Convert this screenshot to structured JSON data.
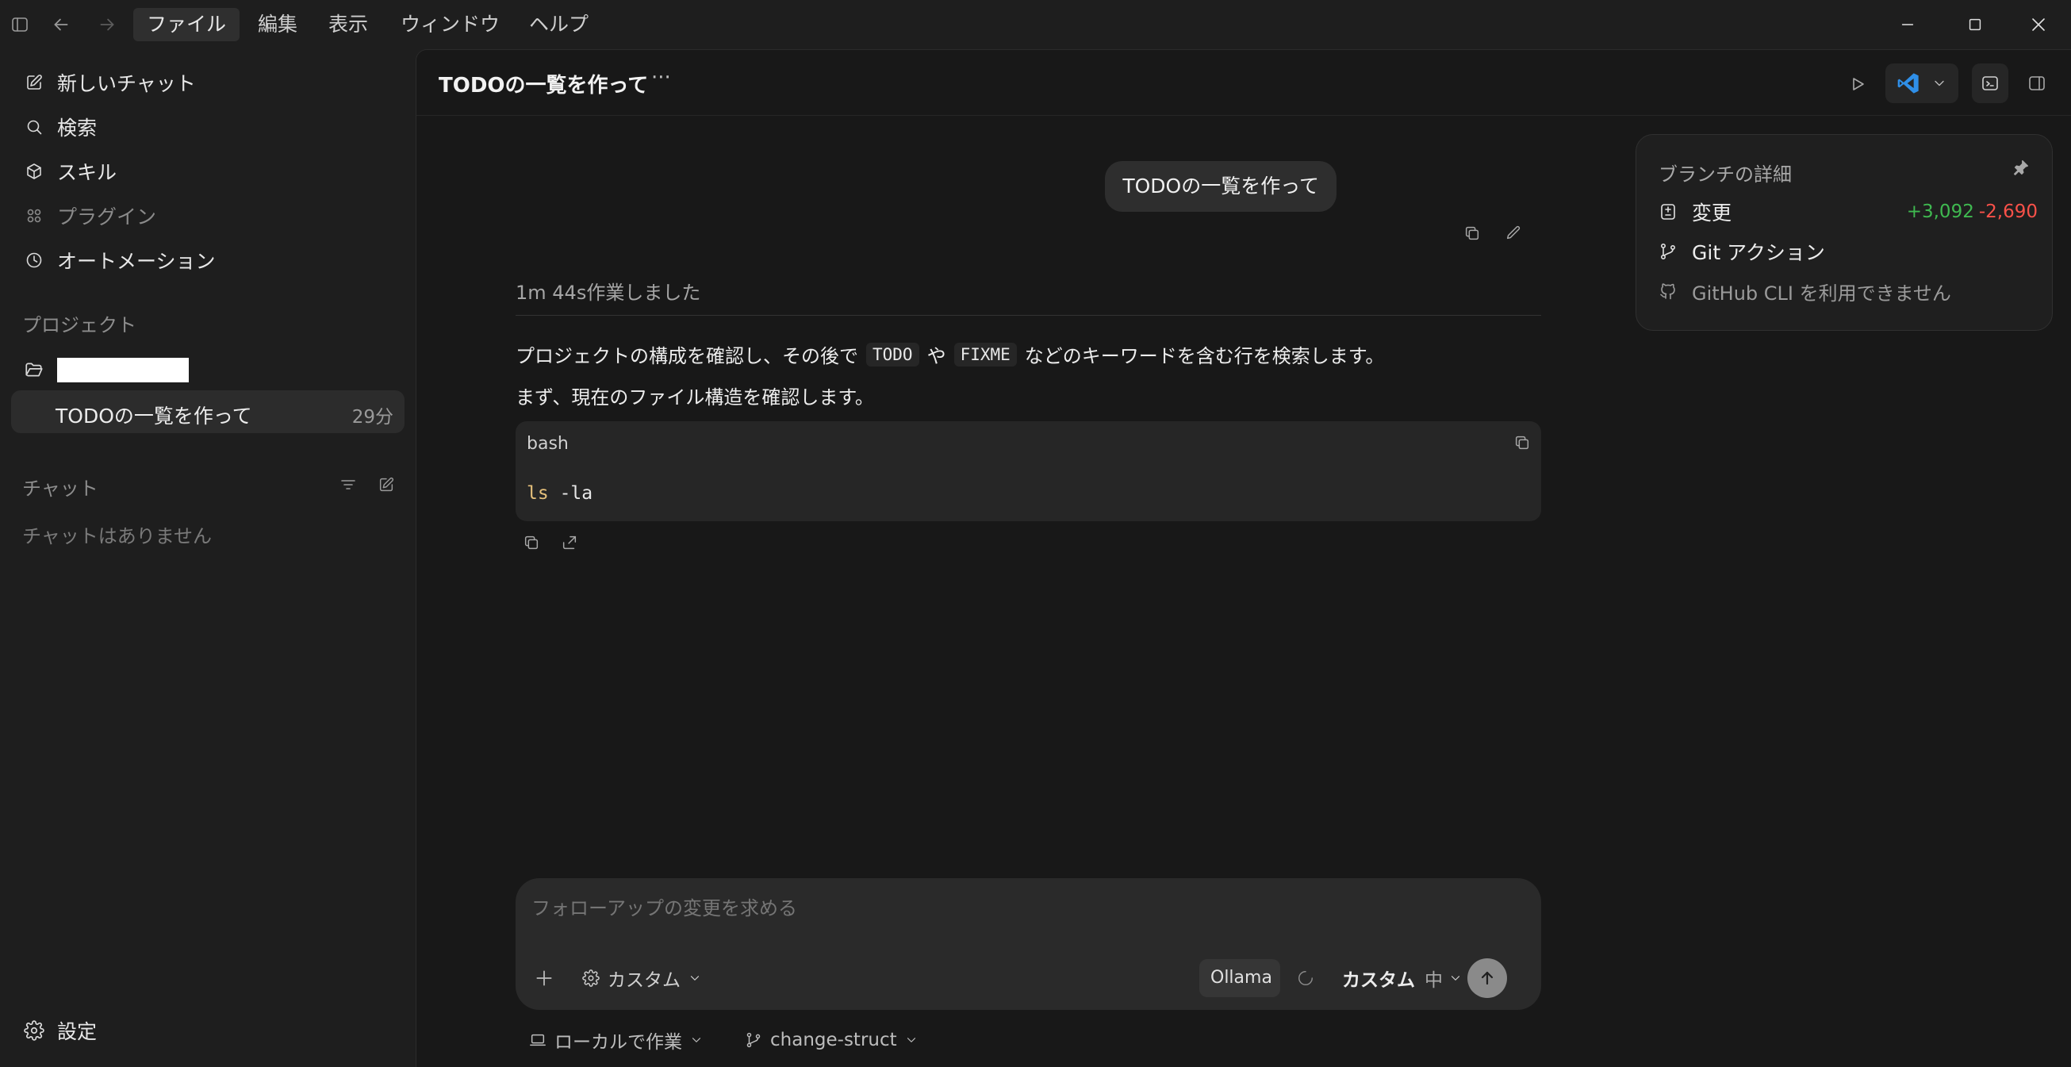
{
  "titlebar": {
    "menu": [
      "ファイル",
      "編集",
      "表示",
      "ウィンドウ",
      "ヘルプ"
    ]
  },
  "sidebar": {
    "nav": [
      {
        "label": "新しいチャット",
        "icon": "edit-icon"
      },
      {
        "label": "検索",
        "icon": "search-icon"
      },
      {
        "label": "スキル",
        "icon": "cube-icon"
      },
      {
        "label": "プラグイン",
        "icon": "grid-icon"
      },
      {
        "label": "オートメーション",
        "icon": "clock-icon"
      }
    ],
    "projects_label": "プロジェクト",
    "project_thread": {
      "title": "TODOの一覧を作って",
      "age": "29分"
    },
    "chats_label": "チャット",
    "chats_empty": "チャットはありません",
    "settings_label": "設定"
  },
  "header": {
    "title": "TODOの一覧を作って",
    "more": "···"
  },
  "conversation": {
    "user_message": "TODOの一覧を作って",
    "worked_for": "1m 44s作業しました",
    "line1_prefix": "プロジェクトの構成を確認し、その後で",
    "code_todo": "TODO",
    "line1_mid": "や",
    "code_fixme": "FIXME",
    "line1_suffix": "などのキーワードを含む行を検索します。",
    "line2": "まず、現在のファイル構造を確認します。",
    "code_lang": "bash",
    "code_cmd": "ls",
    "code_arg": "-la"
  },
  "branch_panel": {
    "title": "ブランチの詳細",
    "changes_label": "変更",
    "additions": "+3,092",
    "deletions": "-2,690",
    "git_actions": "Git アクション",
    "github_cli": "GitHub CLI を利用できません"
  },
  "composer": {
    "placeholder": "フォローアップの変更を求める",
    "mode_label": "カスタム",
    "provider": "Ollama",
    "model_label": "カスタム",
    "effort": "中"
  },
  "footer": {
    "workspace": "ローカルで作業",
    "branch": "change-struct"
  },
  "colors": {
    "additions": "#3fb950",
    "deletions": "#f85149",
    "keyword": "#e5c07b",
    "vscode": "#2f8fe8"
  }
}
